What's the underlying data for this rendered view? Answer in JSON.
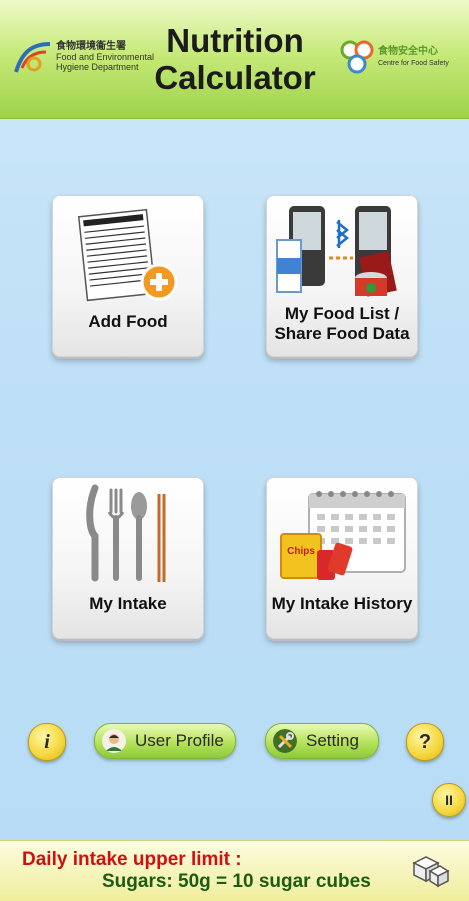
{
  "header": {
    "title_line1": "Nutrition",
    "title_line2": "Calculator",
    "left_logo": {
      "zh": "食物環境衞生署",
      "en1": "Food and Environmental",
      "en2": "Hygiene Department"
    },
    "right_logo": {
      "zh": "食物安全中心",
      "en": "Centre for Food Safety"
    }
  },
  "tiles": [
    {
      "label_line1": "Add Food",
      "label_line2": "",
      "icon": "nutrition-facts-add-icon"
    },
    {
      "label_line1": "My Food List /",
      "label_line2": "Share Food Data",
      "icon": "phones-bluetooth-food-icon"
    },
    {
      "label_line1": "My Intake",
      "label_line2": "",
      "icon": "cutlery-icon"
    },
    {
      "label_line1": "My Intake History",
      "label_line2": "",
      "icon": "calendar-snacks-icon"
    }
  ],
  "toolbar": {
    "info_label": "i",
    "user_profile_label": "User Profile",
    "setting_label": "Setting",
    "help_label": "?",
    "pause_label": "II"
  },
  "banner": {
    "line1": "Daily intake upper limit :",
    "line2": "Sugars: 50g = 10 sugar cubes"
  },
  "colors": {
    "header_green": "#b6e35a",
    "background_blue": "#c3e2f7",
    "banner_red": "#d01010",
    "banner_green": "#1c5c14",
    "button_yellow": "#f4d63c"
  }
}
